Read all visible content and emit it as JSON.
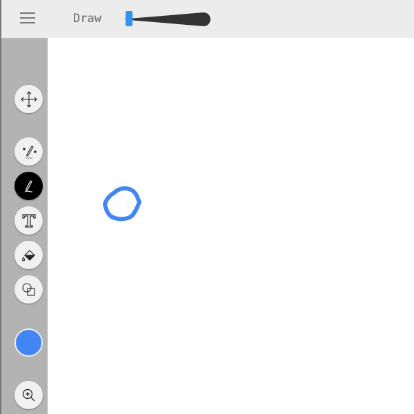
{
  "header": {
    "title": "Draw",
    "menu_icon": "hamburger-icon",
    "brush_size_percent": 5
  },
  "toolbar": {
    "tools": [
      {
        "name": "move",
        "icon": "move-arrows-icon"
      },
      {
        "name": "magic-draw",
        "icon": "magic-pencil-icon"
      },
      {
        "name": "draw",
        "icon": "pencil-icon",
        "active": true
      },
      {
        "name": "text",
        "icon": "text-icon"
      },
      {
        "name": "fill",
        "icon": "paint-bucket-icon"
      },
      {
        "name": "shapes",
        "icon": "shapes-icon"
      }
    ],
    "color": "#4285f4",
    "zoom_icon": "zoom-in-icon"
  },
  "colors": {
    "stroke": "#4285f4",
    "slider_handle": "#2f95f0"
  }
}
